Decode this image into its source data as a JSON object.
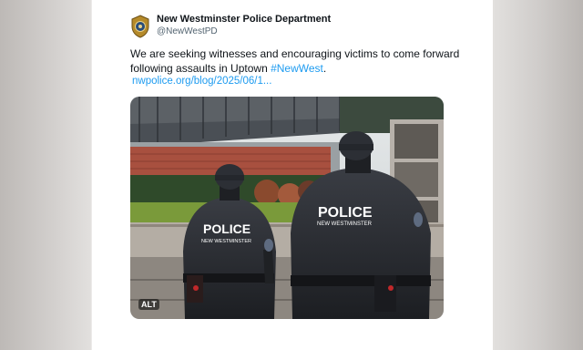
{
  "post": {
    "author_name": "New Westminster Police Department",
    "author_handle": "@NewWestPD",
    "text_main": "We are seeking witnesses and encouraging victims to come forward following assaults in Uptown ",
    "hashtag": "#NewWest",
    "text_end": ".",
    "link": "nwpolice.org/blog/2025/06/1...",
    "avatar_icon": "police-badge-icon"
  },
  "media": {
    "alt_badge": "ALT",
    "vest_text_big": "POLICE",
    "vest_text_small": "NEW WESTMINSTER",
    "vest_text_big_2": "POLICE",
    "vest_text_small_2": "NEW WESTMINSTER"
  },
  "colors": {
    "link": "#1d9bf0",
    "text": "#0f1419",
    "muted": "#536471"
  }
}
